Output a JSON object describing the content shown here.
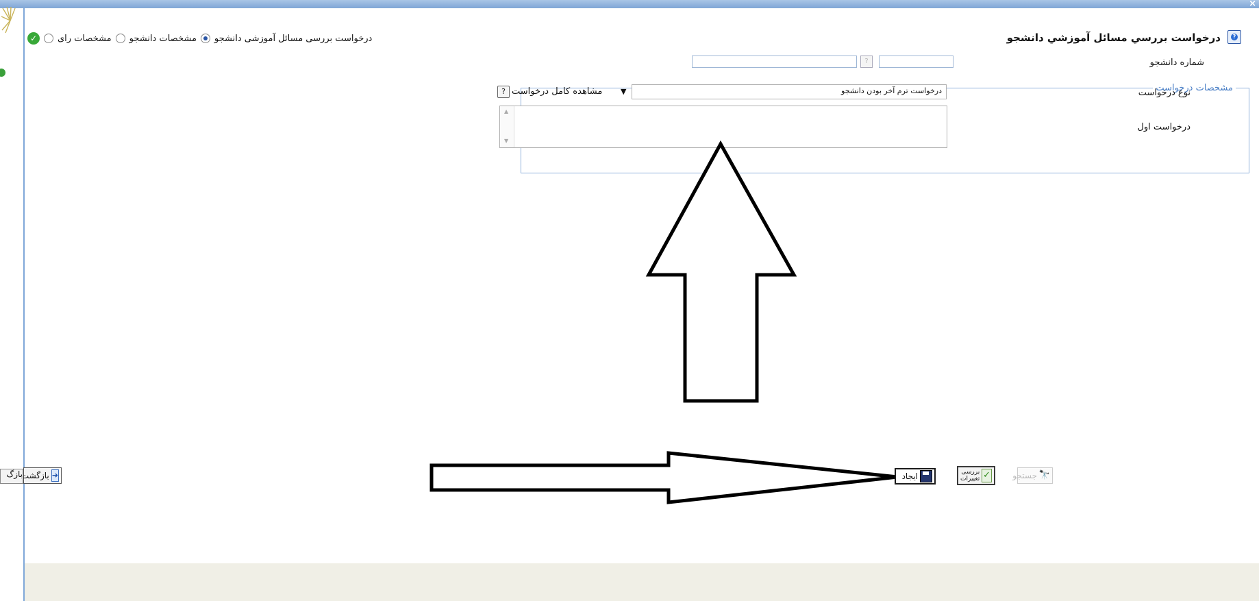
{
  "window": {
    "close_glyph": "×"
  },
  "form": {
    "title": "درخواست بررسي مسائل آموزشي دانشجو"
  },
  "tabs": [
    {
      "label": "درخواست بررسی مسائل آموزشی دانشجو",
      "state": "text"
    },
    {
      "label": "مشخصات دانشجو",
      "state": "selected"
    },
    {
      "label": "مشخصات رای",
      "state": "unselected"
    }
  ],
  "student": {
    "number_label": "شماره دانشجو",
    "number_value": "",
    "name_value": ""
  },
  "request_section": {
    "legend": "مشخصات درخواست",
    "type_label": "نوع درخواست",
    "type_value": "درخواست ترم آخر بودن دانشجو",
    "view_full_label": "مشاهده کامل درخواست",
    "first_request_label": "درخواست اول",
    "first_request_value": ""
  },
  "toolbar": {
    "search_label": "جستجو",
    "review_label_line1": "بررسی",
    "review_label_line2": "تغییرات",
    "create_label": "ایجاد",
    "back_label": "بازگشت",
    "back_partial": "بازگ"
  },
  "colors": {
    "title_bar": "#7fa6d6",
    "accent_blue": "#4a7fc6",
    "status_band": "#f0efe6"
  },
  "icons": [
    "help-icon",
    "radio-icon",
    "check-icon",
    "question-icon",
    "search-binoculars-icon",
    "review-check-icon",
    "save-disk-icon",
    "back-arrow-icon"
  ]
}
